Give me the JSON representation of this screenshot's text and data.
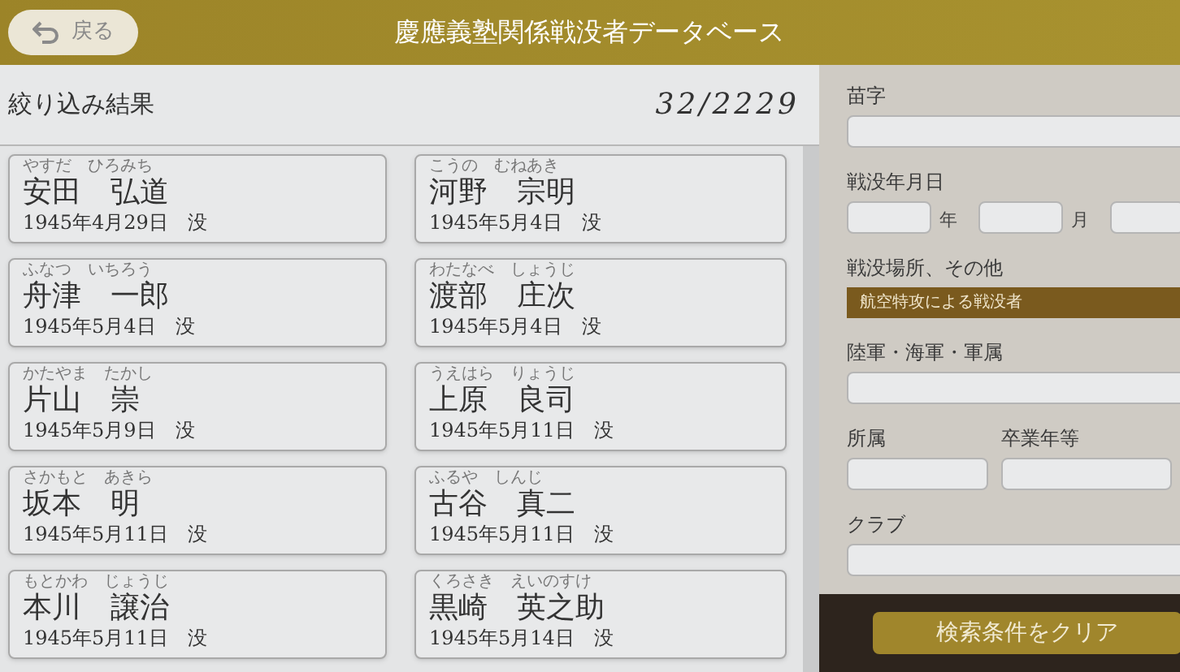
{
  "header": {
    "back_button": "戻る",
    "title": "慶應義塾関係戦没者データベース"
  },
  "results": {
    "title": "絞り込み結果",
    "count": "32/2229",
    "items": [
      {
        "reading": "やすだ　ひろみち",
        "name": "安田　弘道",
        "date": "1945年4月29日　没"
      },
      {
        "reading": "こうの　むねあき",
        "name": "河野　宗明",
        "date": "1945年5月4日　没"
      },
      {
        "reading": "ふなつ　いちろう",
        "name": "舟津　一郎",
        "date": "1945年5月4日　没"
      },
      {
        "reading": "わたなべ　しょうじ",
        "name": "渡部　庄次",
        "date": "1945年5月4日　没"
      },
      {
        "reading": "かたやま　たかし",
        "name": "片山　崇",
        "date": "1945年5月9日　没"
      },
      {
        "reading": "うえはら　りょうじ",
        "name": "上原　良司",
        "date": "1945年5月11日　没"
      },
      {
        "reading": "さかもと　あきら",
        "name": "坂本　明",
        "date": "1945年5月11日　没"
      },
      {
        "reading": "ふるや　しんじ",
        "name": "古谷　真二",
        "date": "1945年5月11日　没"
      },
      {
        "reading": "もとかわ　じょうじ",
        "name": "本川　譲治",
        "date": "1945年5月11日　没"
      },
      {
        "reading": "くろさき　えいのすけ",
        "name": "黒崎　英之助",
        "date": "1945年5月14日　没"
      }
    ]
  },
  "filters": {
    "surname": {
      "label": "苗字"
    },
    "death_date": {
      "label": "戦没年月日",
      "year_unit": "年",
      "month_unit": "月"
    },
    "place": {
      "label": "戦没場所、その他",
      "value": "航空特攻による戦没者"
    },
    "branch": {
      "label": "陸軍・海軍・軍属"
    },
    "unit": {
      "label": "所属"
    },
    "graduation": {
      "label": "卒業年等"
    },
    "club": {
      "label": "クラブ"
    },
    "clear_button": "検索条件をクリア"
  }
}
